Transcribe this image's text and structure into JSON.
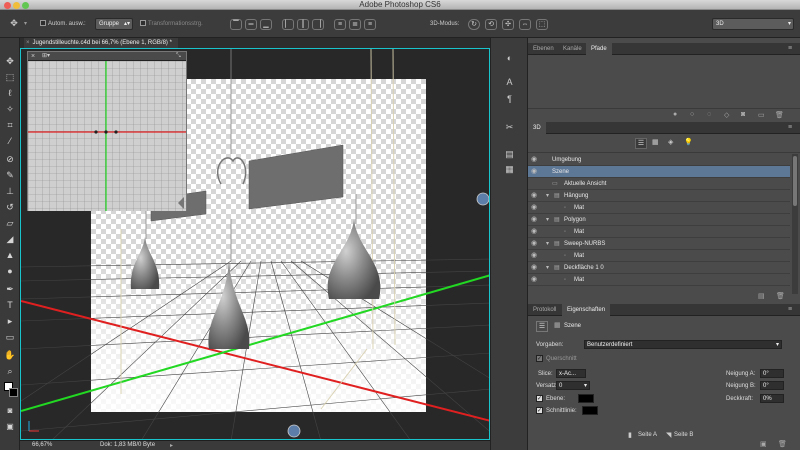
{
  "app": {
    "title": "Adobe Photoshop CS6"
  },
  "options_bar": {
    "auto_select_label": "Autom. ausw.:",
    "auto_select_value": "Gruppe",
    "transform_controls_label": "Transformationsstrg.",
    "mode_3d_label": "3D-Modus:",
    "workspace": "3D"
  },
  "document": {
    "tab_label": "Jugendstilleuchte.c4d bei 66,7% (Ebene 1, RGB/8) *",
    "zoom": "66,67%",
    "doc_info": "Dok: 1,83 MB/0 Byte"
  },
  "layers_panel": {
    "tabs": [
      "Ebenen",
      "Kanäle",
      "Pfade"
    ],
    "active_tab": "Pfade"
  },
  "panel_3d": {
    "tab": "3D",
    "items": [
      {
        "label": "Umgebung",
        "level": 0,
        "selected": false
      },
      {
        "label": "Szene",
        "level": 0,
        "selected": true
      },
      {
        "label": "Aktuelle Ansicht",
        "level": 1,
        "selected": false
      },
      {
        "label": "Hängung",
        "level": 1,
        "selected": false
      },
      {
        "label": "Mat",
        "level": 2,
        "selected": false
      },
      {
        "label": "Polygon",
        "level": 1,
        "selected": false
      },
      {
        "label": "Mat",
        "level": 2,
        "selected": false
      },
      {
        "label": "Sweep-NURBS",
        "level": 1,
        "selected": false
      },
      {
        "label": "Mat",
        "level": 2,
        "selected": false
      },
      {
        "label": "Deckfläche 1 0",
        "level": 1,
        "selected": false
      },
      {
        "label": "Mat",
        "level": 2,
        "selected": false
      }
    ]
  },
  "properties_panel": {
    "tabs": [
      "Protokoll",
      "Eigenschaften"
    ],
    "active_tab": "Eigenschaften",
    "title": "Szene",
    "presets_label": "Vorgaben:",
    "presets_value": "Benutzerdefiniert",
    "cross_section_label": "Querschnitt",
    "slice_label": "Slice:",
    "slice_value": "x-Ac...",
    "offset_label": "Versatz:",
    "offset_value": "0",
    "plane_label": "Ebene:",
    "intersection_label": "Schnittlinie:",
    "tilt_a_label": "Neigung A:",
    "tilt_a_value": "0°",
    "tilt_b_label": "Neigung B:",
    "tilt_b_value": "0°",
    "opacity_label": "Deckkraft:",
    "opacity_value": "0%",
    "side_a_label": "Seite A",
    "side_b_label": "Seite B"
  },
  "colors": {
    "accent_selection": "#5d7796",
    "canvas_border": "#19c4cc",
    "x_axis": "#e02020",
    "z_axis": "#22d822"
  }
}
